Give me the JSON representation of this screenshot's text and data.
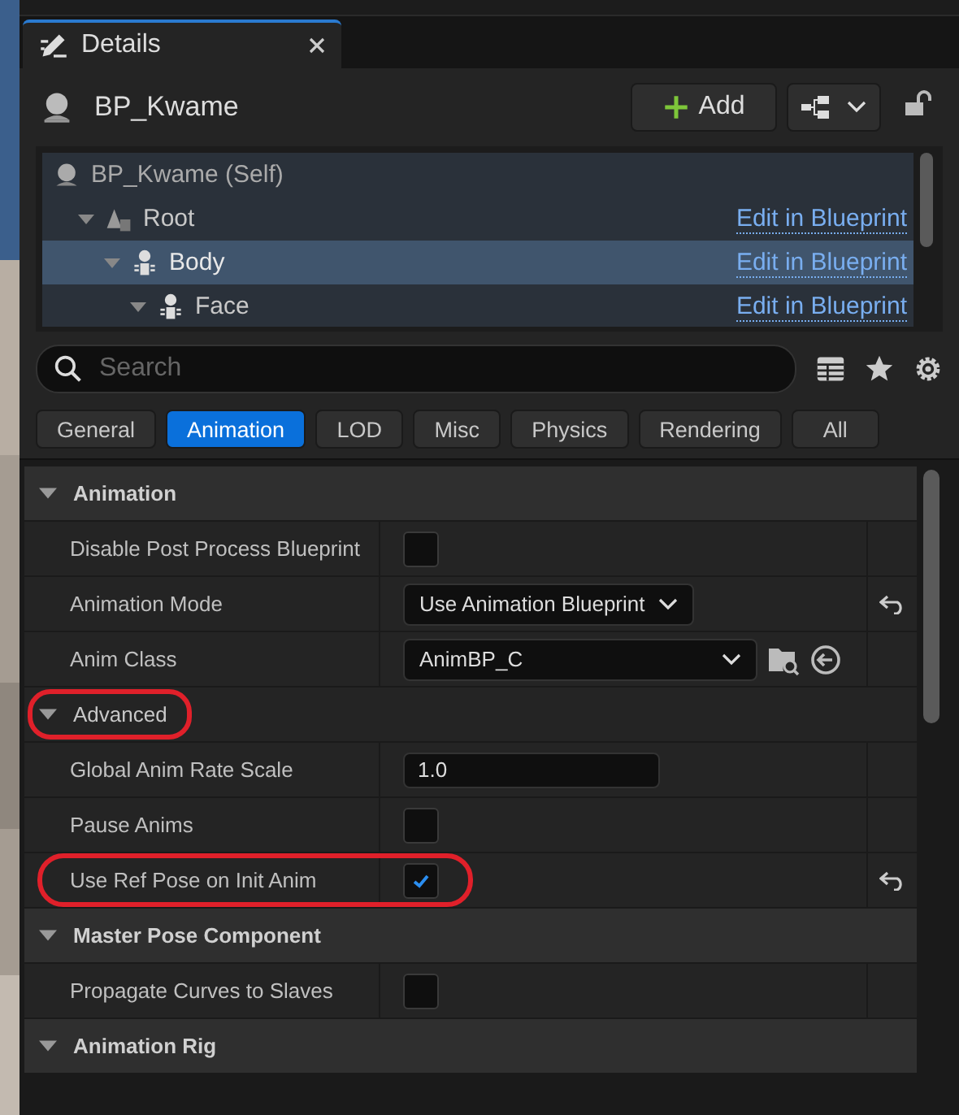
{
  "tab": {
    "title": "Details",
    "selected": true
  },
  "header": {
    "name": "BP_Kwame",
    "add_label": "Add"
  },
  "tree": [
    {
      "label": "BP_Kwame (Self)",
      "kind": "actor",
      "selected": false,
      "children": [
        {
          "label": "Root",
          "kind": "scene",
          "selected": false,
          "expanded": true,
          "link": "Edit in Blueprint",
          "children": [
            {
              "label": "Body",
              "kind": "skeleton",
              "selected": true,
              "expanded": true,
              "link": "Edit in Blueprint",
              "children": [
                {
                  "label": "Face",
                  "kind": "skeleton",
                  "selected": false,
                  "expanded": true,
                  "link": "Edit in Blueprint"
                }
              ]
            }
          ]
        }
      ]
    }
  ],
  "search": {
    "placeholder": "Search"
  },
  "filters": [
    {
      "label": "General",
      "selected": false
    },
    {
      "label": "Animation",
      "selected": true
    },
    {
      "label": "LOD",
      "selected": false
    },
    {
      "label": "Misc",
      "selected": false
    },
    {
      "label": "Physics",
      "selected": false
    },
    {
      "label": "Rendering",
      "selected": false
    },
    {
      "label": "All",
      "selected": false
    }
  ],
  "sections": [
    {
      "title": "Animation",
      "kind": "category",
      "expanded": true,
      "highlighted": false,
      "rows": [
        {
          "label": "Disable Post Process Blueprint",
          "kind": "checkbox",
          "checked": false,
          "highlighted": false
        },
        {
          "label": "Animation Mode",
          "kind": "dropdown",
          "value": "Use Animation Blueprint",
          "reset": true,
          "highlighted": false
        },
        {
          "label": "Anim Class",
          "kind": "asset",
          "value": "AnimBP_C",
          "highlighted": false
        }
      ]
    },
    {
      "title": "Advanced",
      "kind": "subcategory",
      "expanded": true,
      "highlighted": true,
      "rows": [
        {
          "label": "Global Anim Rate Scale",
          "kind": "number",
          "value": "1.0",
          "highlighted": false
        },
        {
          "label": "Pause Anims",
          "kind": "checkbox",
          "checked": false,
          "highlighted": false
        },
        {
          "label": "Use Ref Pose on Init Anim",
          "kind": "checkbox",
          "checked": true,
          "reset": true,
          "highlighted": true
        }
      ]
    },
    {
      "title": "Master Pose Component",
      "kind": "category",
      "expanded": true,
      "highlighted": false,
      "rows": [
        {
          "label": "Propagate Curves to Slaves",
          "kind": "checkbox",
          "checked": false,
          "highlighted": false
        }
      ]
    },
    {
      "title": "Animation Rig",
      "kind": "category",
      "expanded": true,
      "highlighted": false
    }
  ]
}
